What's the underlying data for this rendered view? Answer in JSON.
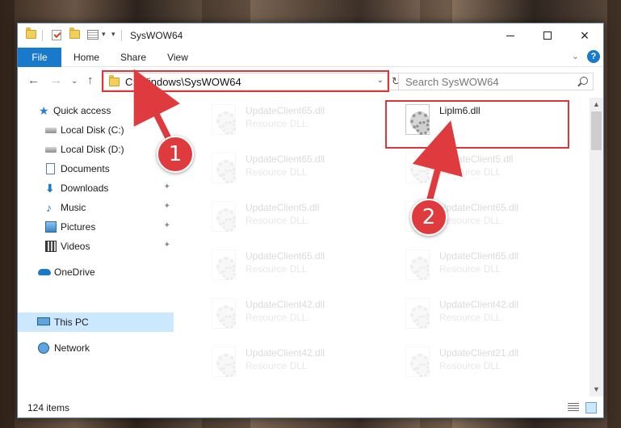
{
  "window": {
    "title": "SysWOW64",
    "controls": {
      "minimize": "minimize-icon",
      "maximize": "maximize-icon",
      "close": "×"
    }
  },
  "ribbon": {
    "tabs": [
      {
        "label": "File"
      },
      {
        "label": "Share"
      },
      {
        "label": "Home"
      },
      {
        "label": "View"
      }
    ],
    "expand_glyph": "⌄",
    "help_glyph": "?"
  },
  "nav": {
    "back": "←",
    "forward": "→",
    "recent": "⌄",
    "up": "↑",
    "address": "C:\\Windows\\SysWOW64",
    "address_drop": "⌄",
    "refresh": "↻",
    "search_placeholder": "Search SysWOW64"
  },
  "sidebar": {
    "items": [
      {
        "label": "Quick access",
        "icon": "star-icon"
      },
      {
        "label": "Local Disk (C:)",
        "icon": "drive-icon"
      },
      {
        "label": "Local Disk (D:)",
        "icon": "drive-icon"
      },
      {
        "label": "Documents",
        "icon": "documents-icon"
      },
      {
        "label": "Downloads",
        "icon": "download-icon"
      },
      {
        "label": "Music",
        "icon": "music-icon"
      },
      {
        "label": "Pictures",
        "icon": "pictures-icon"
      },
      {
        "label": "Videos",
        "icon": "videos-icon"
      },
      {
        "label": "OneDrive",
        "icon": "onedrive-icon"
      },
      {
        "label": "This PC",
        "icon": "pc-icon",
        "selected": true
      },
      {
        "label": "Network",
        "icon": "network-icon"
      }
    ],
    "pin_glyph": "📌"
  },
  "files": {
    "left": [
      {
        "name": "UpdateClient65.dll",
        "type": "Resource DLL"
      },
      {
        "name": "UpdateClient65.dll",
        "type": "Resource DLL"
      },
      {
        "name": "UpdateClient5.dll",
        "type": "Resource DLL"
      },
      {
        "name": "UpdateClient65.dll",
        "type": "Resource DLL"
      },
      {
        "name": "UpdateClient42.dll",
        "type": "Resource DLL"
      },
      {
        "name": "UpdateClient42.dll",
        "type": "Resource DLL"
      }
    ],
    "right": [
      {
        "name": "Liplm6.dll",
        "type": ""
      },
      {
        "name": "UpdateClient5.dll",
        "type": "Resource DLL"
      },
      {
        "name": "UpdateClient65.dll",
        "type": "Resource DLL"
      },
      {
        "name": "UpdateClient65.dll",
        "type": "Resource DLL"
      },
      {
        "name": "UpdateClient42.dll",
        "type": "Resource DLL"
      },
      {
        "name": "UpdateClient21.dll",
        "type": "Resource DLL"
      }
    ]
  },
  "scroll": {
    "up": "▲",
    "down": "▼"
  },
  "status": {
    "items": "124 items"
  },
  "annotations": {
    "step1": "1",
    "step2": "2",
    "color": "#df3b3f"
  }
}
